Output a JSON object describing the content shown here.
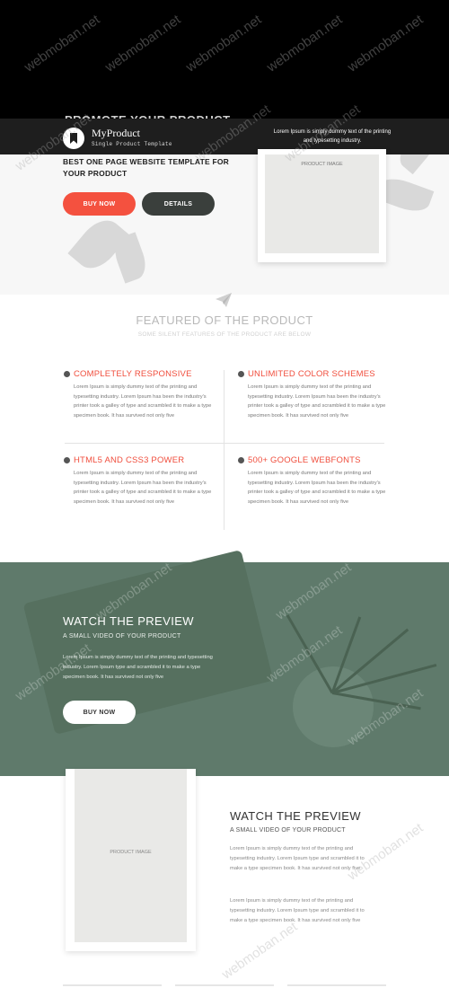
{
  "brand": {
    "name": "MyProduct",
    "tagline": "Single Product Template",
    "description": "Lorem Ipsum is simply dummy text of the printing and typesetting industry."
  },
  "hero": {
    "ghost_heading": "PROMOTE YOUR PRODUCT TEMPLATE",
    "title": "BEST ONE PAGE WEBSITE TEMPLATE FOR YOUR PRODUCT",
    "buy_label": "BUY NOW",
    "details_label": "DETAILS",
    "image_label": "PRODUCT IMAGE"
  },
  "features": {
    "title": "FEATURED OF THE PRODUCT",
    "subtitle": "SOME SILENT FEATURES OF THE PRODUCT ARE BELOW",
    "items": [
      {
        "title": "COMPLETELY RESPONSIVE",
        "text": "Lorem Ipsum is simply dummy text of the printing and typesetting industry. Lorem Ipsum has been the industry's printer took a galley of type and scrambled it to make a type specimen book. It has survived not only five"
      },
      {
        "title": "UNLIMITED COLOR SCHEMES",
        "text": "Lorem Ipsum is simply dummy text of the printing and typesetting industry. Lorem Ipsum has been the industry's printer took a galley of type and scrambled it to make a type specimen book. It has survived not only five"
      },
      {
        "title": "HTML5 AND CSS3 POWER",
        "text": "Lorem Ipsum is simply dummy text of the printing and typesetting industry. Lorem Ipsum has been the industry's printer took a galley of type and scrambled it to make a type specimen book. It has survived not only five"
      },
      {
        "title": "500+ GOOGLE WEBFONTS",
        "text": "Lorem Ipsum is simply dummy text of the printing and typesetting industry. Lorem Ipsum has been the industry's printer took a galley of type and scrambled it to make a type specimen book. It has survived not only five"
      }
    ]
  },
  "video": {
    "title": "WATCH THE PREVIEW",
    "subtitle": "A SMALL VIDEO OF YOUR PRODUCT",
    "text": "Lorem Ipsum is simply dummy text of the printing and typesetting industry. Lorem Ipsum type and scrambled it to make a type specimen book. It has survived not only five",
    "button_label": "BUY NOW"
  },
  "preview": {
    "image_label": "PRODUCT IMAGE",
    "title": "WATCH THE PREVIEW",
    "subtitle": "A SMALL VIDEO OF YOUR PRODUCT",
    "paragraph1": "Lorem Ipsum is simply dummy text of the printing and typesetting industry. Lorem Ipsum type and scrambled it to make a type specimen book. It has survived not only five",
    "paragraph2": "Lorem Ipsum is simply dummy text of the printing and typesetting industry. Lorem Ipsum type and scrambled it to make a type specimen book. It has survived not only five"
  },
  "watermark": "webmoban.net",
  "colors": {
    "accent": "#f4513f",
    "dark_button": "#3a3f3c",
    "section_green": "#5f7a6b",
    "nav_bg": "#1e1e1e"
  },
  "icons": {
    "logo": "bookmark-icon",
    "divider": "paper-plane-icon"
  }
}
